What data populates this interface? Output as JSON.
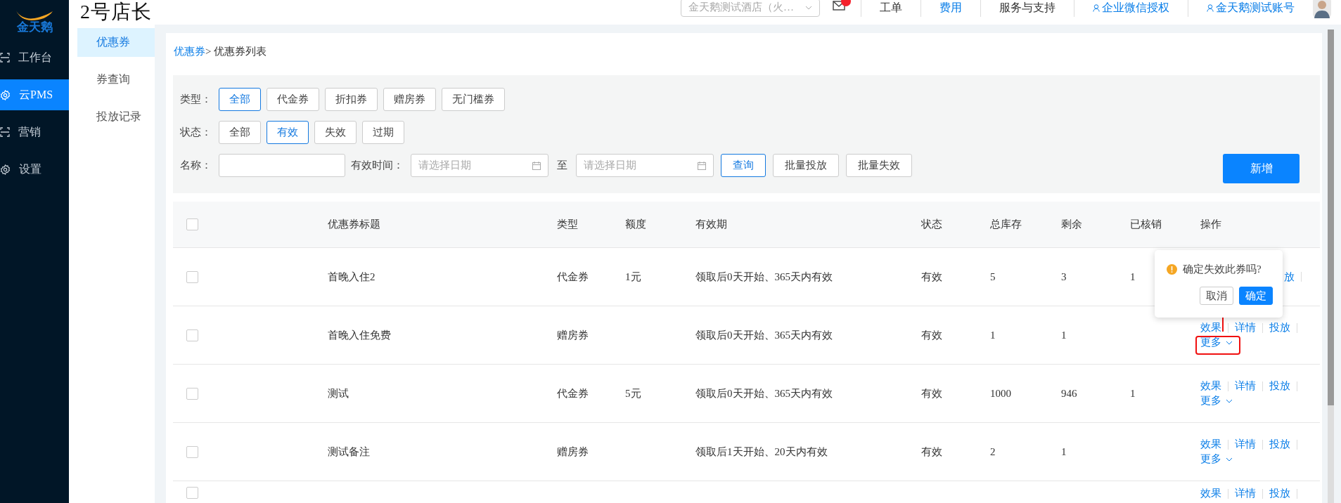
{
  "brand": {
    "logo_text": "金天鹅",
    "app_title": "2号店长"
  },
  "sidebar": {
    "items": [
      {
        "label": "工作台",
        "kind": "frame",
        "selected": false
      },
      {
        "label": "云PMS",
        "kind": "gear",
        "selected": true
      },
      {
        "label": "营销",
        "kind": "frame",
        "selected": false
      },
      {
        "label": "设置",
        "kind": "gear",
        "selected": false
      }
    ]
  },
  "subnav": {
    "items": [
      {
        "label": "优惠券",
        "selected": true
      },
      {
        "label": "券查询",
        "selected": false
      },
      {
        "label": "投放记录",
        "selected": false
      }
    ]
  },
  "header": {
    "hotel_select": "金天鹅测试酒店（火…",
    "links": [
      {
        "label": "工单",
        "kind": "plain"
      },
      {
        "label": "费用",
        "kind": "link"
      },
      {
        "label": "服务与支持",
        "kind": "plain"
      },
      {
        "label": "企业微信授权",
        "kind": "user"
      },
      {
        "label": "金天鹅测试账号",
        "kind": "user"
      }
    ]
  },
  "breadcrumb": {
    "parent": "优惠券",
    "current": "> 优惠券列表"
  },
  "filters": {
    "type": {
      "label": "类型：",
      "options": [
        {
          "label": "全部",
          "selected": true
        },
        {
          "label": "代金券",
          "selected": false
        },
        {
          "label": "折扣券",
          "selected": false
        },
        {
          "label": "赠房券",
          "selected": false
        },
        {
          "label": "无门槛券",
          "selected": false
        }
      ]
    },
    "status": {
      "label": "状态：",
      "options": [
        {
          "label": "全部",
          "selected": false
        },
        {
          "label": "有效",
          "selected": true
        },
        {
          "label": "失效",
          "selected": false
        },
        {
          "label": "过期",
          "selected": false
        }
      ]
    },
    "name": {
      "label": "名称："
    },
    "valid_time": {
      "label": "有效时间：",
      "start_placeholder": "请选择日期",
      "separator": "至",
      "end_placeholder": "请选择日期"
    },
    "buttons": [
      {
        "label": "查询",
        "kind": "primary"
      },
      {
        "label": "批量投放",
        "kind": "default"
      },
      {
        "label": "批量失效",
        "kind": "default"
      }
    ],
    "add_button": "新增"
  },
  "table": {
    "select_all_checked": false,
    "columns": [
      "优惠券标题",
      "类型",
      "额度",
      "有效期",
      "状态",
      "总库存",
      "剩余",
      "已核销",
      "操作"
    ],
    "rows": [
      {
        "checked": false,
        "title": "首晚入住2",
        "type": "代金券",
        "amount": "1元",
        "validity": "领取后0天开始、365天内有效",
        "status": "有效",
        "stock": "5",
        "remaining": "3",
        "verified": "1",
        "covered": true,
        "actions": [
          "放"
        ]
      },
      {
        "checked": false,
        "title": "首晚入住免费",
        "type": "赠房券",
        "validity": "领取后0天开始、365天内有效",
        "status": "有效",
        "stock": "1",
        "remaining": "1",
        "covered": false,
        "actions": [
          "效果",
          "详情",
          "投放"
        ],
        "more": "更多"
      },
      {
        "checked": false,
        "title": "测试",
        "type": "代金券",
        "amount": "5元",
        "validity": "领取后0天开始、365天内有效",
        "status": "有效",
        "stock": "1000",
        "remaining": "946",
        "verified": "1",
        "covered": false,
        "actions": [
          "效果",
          "详情",
          "投放"
        ],
        "more": "更多"
      },
      {
        "checked": false,
        "title": "测试备注",
        "type": "赠房券",
        "validity": "领取后1天开始、20天内有效",
        "status": "有效",
        "stock": "2",
        "remaining": "1",
        "covered": false,
        "actions": [
          "效果",
          "详情",
          "投放"
        ],
        "more": "更多"
      },
      {
        "checked": false,
        "covered": false,
        "actions": [
          "效果",
          "详情",
          "投放"
        ]
      }
    ]
  },
  "popconfirm": {
    "message": "确定失效此券吗?",
    "cancel": "取消",
    "confirm": "确定"
  }
}
